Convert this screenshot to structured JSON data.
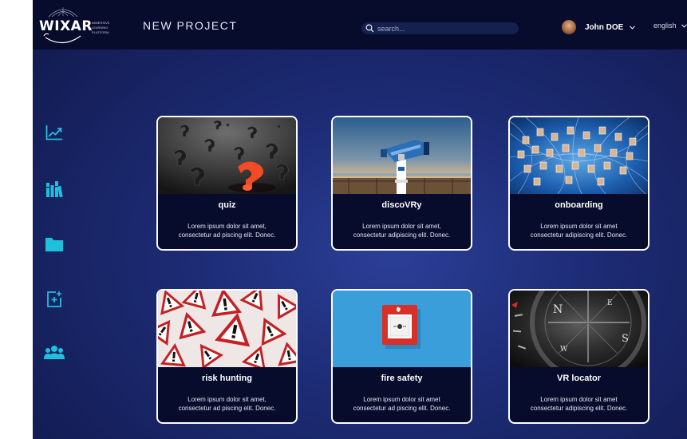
{
  "header": {
    "logo_text": "WIXAR",
    "logo_subtitle": [
      "IMMERSIVE",
      "LEARNING",
      "PLATFORM"
    ],
    "project_title": "NEW PROJECT",
    "search_placeholder": "search...",
    "user_name": "John DOE",
    "language": "english"
  },
  "sidebar": {
    "items": [
      {
        "name": "analytics",
        "icon": "chart-line-icon"
      },
      {
        "name": "library",
        "icon": "books-icon"
      },
      {
        "name": "folders",
        "icon": "folder-icon"
      },
      {
        "name": "new-project",
        "icon": "add-document-icon"
      },
      {
        "name": "users",
        "icon": "users-icon"
      }
    ]
  },
  "projects": [
    {
      "title": "quiz",
      "desc1": "Lorem ipsum dolor sit amet,",
      "desc2": "consectetur ad piscing elit. Donec."
    },
    {
      "title": "discoVRy",
      "desc1": "Lorem ipsum dolor sit amet,",
      "desc2": "consectetur adipiscing elit. Donec."
    },
    {
      "title": "onboarding",
      "desc1": "Lorem ipsum dolor sit amet",
      "desc2": "consectetur adipiscing elit. Donec."
    },
    {
      "title": "risk hunting",
      "desc1": "Lorem ipsum dolor sit amet,",
      "desc2": "consectetur ad piscing elit. Donec."
    },
    {
      "title": "fire safety",
      "desc1": "Lorem ipsum dolor sit amet",
      "desc2": "consectetur ad piscing elit. Donec."
    },
    {
      "title": "VR locator",
      "desc1": "Lorem ipsum dolor sit amet",
      "desc2": "consectetur adipiscing elit. Donec."
    }
  ],
  "colors": {
    "topbar": "#070b2c",
    "background": "#1d2b74",
    "accent": "#1ec0dd",
    "card_border": "#ffffff"
  }
}
